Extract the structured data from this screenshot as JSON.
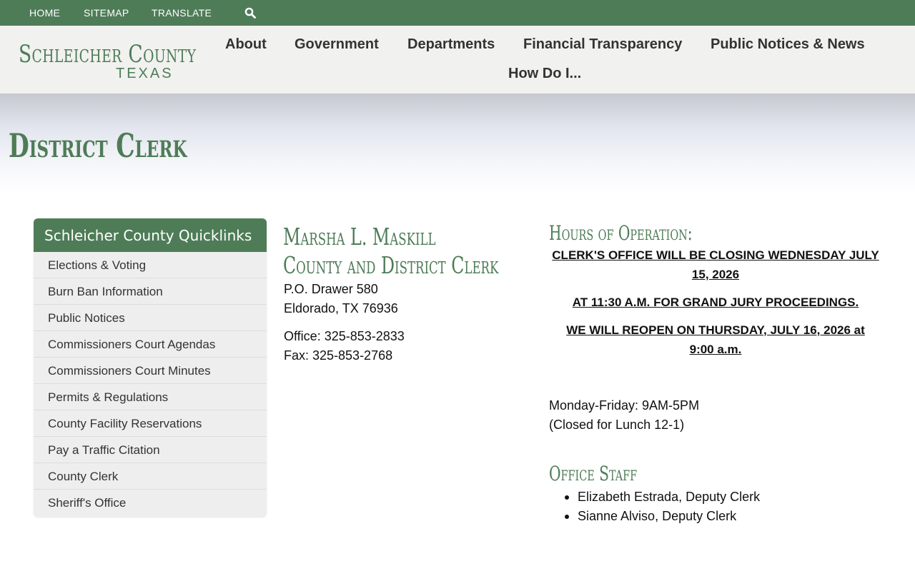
{
  "topbar": {
    "links": [
      "HOME",
      "SITEMAP",
      "TRANSLATE"
    ],
    "search_icon": "search-icon",
    "color": "#4e7c57"
  },
  "header": {
    "logo_title": "Schleicher County",
    "logo_subtitle": "TEXAS",
    "nav": [
      "About",
      "Government",
      "Departments",
      "Financial Transparency",
      "Public Notices & News",
      "How Do I..."
    ]
  },
  "page": {
    "title": "District Clerk"
  },
  "quicklinks": {
    "title": "Schleicher County Quicklinks",
    "items": [
      "Elections & Voting",
      "Burn Ban Information",
      "Public Notices",
      "Commissioners Court Agendas",
      "Commissioners Court Minutes",
      "Permits & Regulations",
      "County Facility Reservations",
      "Pay a Traffic Citation",
      "County Clerk",
      "Sheriff's Office"
    ]
  },
  "clerk": {
    "name": "Marsha L. Maskill",
    "title": "County and District Clerk",
    "address_line1": "P.O. Drawer 580",
    "address_line2": "Eldorado, TX 76936",
    "office": "Office: 325-853-2833",
    "fax": "Fax: 325-853-2768"
  },
  "hours": {
    "heading": "Hours of Operation:",
    "notice1": "CLERK'S OFFICE WILL BE CLOSING WEDNESDAY JULY 15, 2026",
    "notice2": "AT 11:30 A.M. FOR GRAND JURY PROCEEDINGS.",
    "notice3": "WE WILL REOPEN ON THURSDAY, JULY 16, 2026 at 9:00 a.m.",
    "schedule": "Monday-Friday: 9AM-5PM",
    "lunch": "(Closed for Lunch 12-1)"
  },
  "staff": {
    "heading": "Office Staff",
    "members": [
      "Elizabeth Estrada, Deputy Clerk",
      "Sianne Alviso, Deputy Clerk"
    ]
  }
}
